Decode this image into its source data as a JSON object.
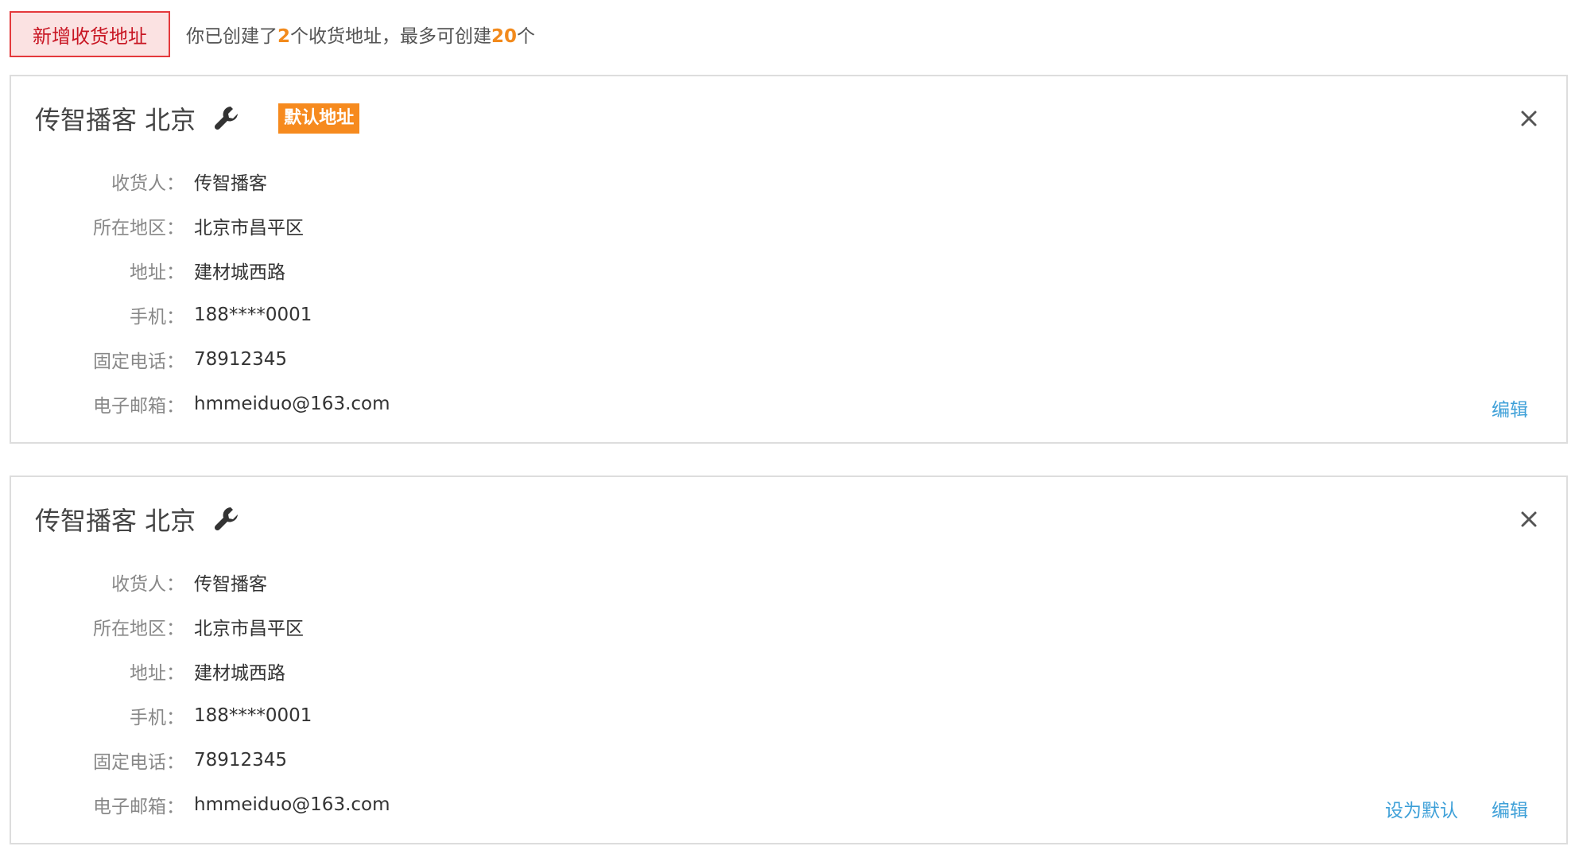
{
  "toolbar": {
    "add_label": "新增收货地址",
    "summary_prefix": "你已创建了",
    "created_count": "2",
    "summary_middle": "个收货地址，最多可创建",
    "max_count": "20",
    "summary_suffix": "个"
  },
  "colors": {
    "accent_red": "#e4393c",
    "highlight_orange": "#f28a1c",
    "link_blue": "#3ea0d8"
  },
  "addresses": [
    {
      "title": "传智播客 北京",
      "is_default": true,
      "default_badge": "默认地址",
      "fields": [
        {
          "label": "收货人：",
          "value": "传智播客"
        },
        {
          "label": "所在地区：",
          "value": "北京市昌平区"
        },
        {
          "label": "地址：",
          "value": "建材城西路"
        },
        {
          "label": "手机：",
          "value": "188****0001"
        },
        {
          "label": "固定电话：",
          "value": "78912345"
        },
        {
          "label": "电子邮箱：",
          "value": "hmmeiduo@163.com"
        }
      ],
      "actions": {
        "edit": "编辑"
      },
      "icons": {
        "edit_title": "wrench-icon",
        "delete": "close-icon"
      }
    },
    {
      "title": "传智播客 北京",
      "is_default": false,
      "fields": [
        {
          "label": "收货人：",
          "value": "传智播客"
        },
        {
          "label": "所在地区：",
          "value": "北京市昌平区"
        },
        {
          "label": "地址：",
          "value": "建材城西路"
        },
        {
          "label": "手机：",
          "value": "188****0001"
        },
        {
          "label": "固定电话：",
          "value": "78912345"
        },
        {
          "label": "电子邮箱：",
          "value": "hmmeiduo@163.com"
        }
      ],
      "actions": {
        "set_default": "设为默认",
        "edit": "编辑"
      },
      "icons": {
        "edit_title": "wrench-icon",
        "delete": "close-icon"
      }
    }
  ]
}
